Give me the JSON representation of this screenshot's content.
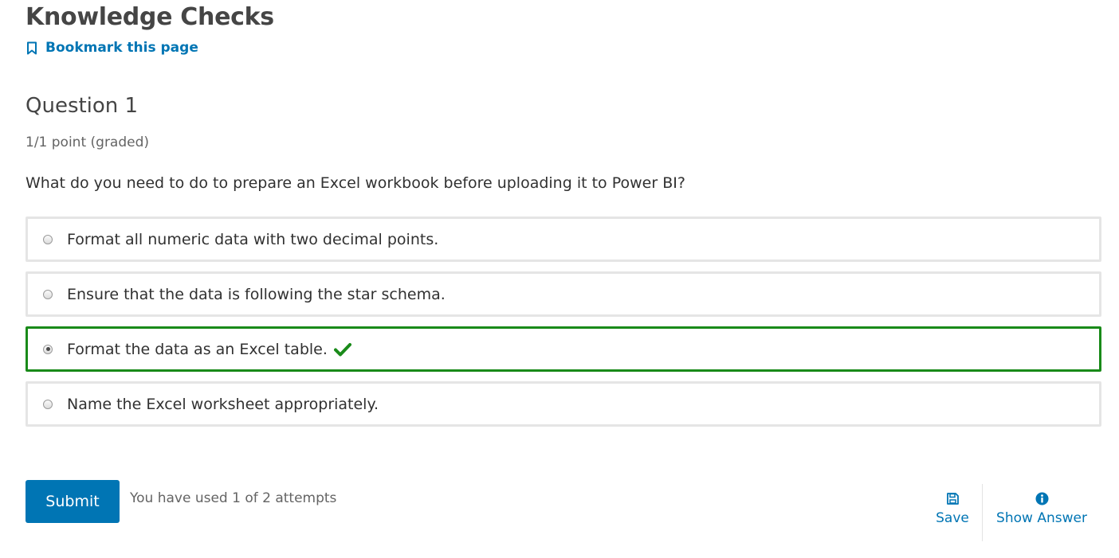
{
  "page": {
    "title": "Knowledge Checks",
    "bookmark_label": "Bookmark this page"
  },
  "question": {
    "title": "Question 1",
    "points": "1/1 point (graded)",
    "prompt": "What do you need to do to prepare an Excel workbook before uploading it to Power BI?",
    "choices": [
      {
        "label": "Format all numeric data with two decimal points.",
        "selected": false,
        "correct": false
      },
      {
        "label": "Ensure that the data is following the star schema.",
        "selected": false,
        "correct": false
      },
      {
        "label": "Format the data as an Excel table.",
        "selected": true,
        "correct": true
      },
      {
        "label": "Name the Excel worksheet appropriately.",
        "selected": false,
        "correct": false
      }
    ]
  },
  "footer": {
    "submit_label": "Submit",
    "attempts_text": "You have used 1 of 2 attempts",
    "save_label": "Save",
    "show_answer_label": "Show Answer"
  },
  "icons": {
    "bookmark": "bookmark-icon",
    "check": "check-icon",
    "save": "save-icon",
    "info": "info-icon"
  },
  "colors": {
    "accent": "#0075b4",
    "correct": "#198a19",
    "border": "#e5e5e5"
  }
}
